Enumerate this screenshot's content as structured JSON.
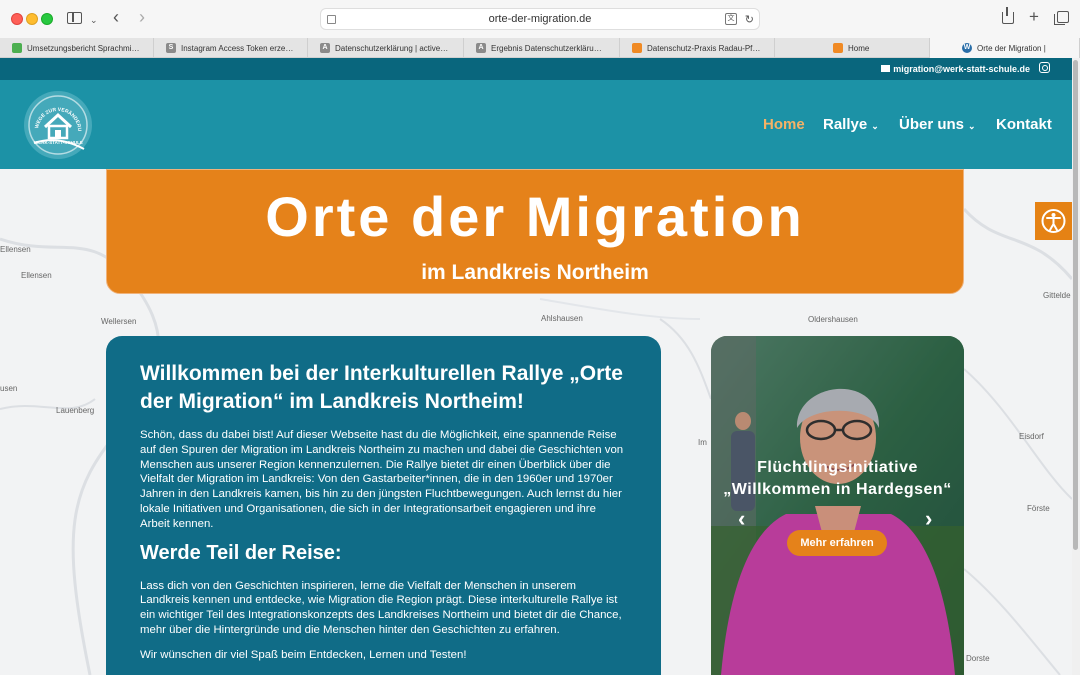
{
  "browser": {
    "url": "orte-der-migration.de",
    "tabs": [
      {
        "label": "Umsetzungsbericht Sprachmi…",
        "fav": "",
        "color": "#4caf50"
      },
      {
        "label": "Instagram Access Token erze…",
        "fav": "S",
        "color": "#8a8a8a"
      },
      {
        "label": "Datenschutzerklärung | active…",
        "fav": "A",
        "color": "#8a8a8a"
      },
      {
        "label": "Ergebnis Datenschutzerkläru…",
        "fav": "A",
        "color": "#8a8a8a"
      },
      {
        "label": "Datenschutz-Praxis Radau-Pf…",
        "fav": "",
        "color": "#f08a24"
      },
      {
        "label": "Home",
        "fav": "",
        "color": "#f08a24"
      },
      {
        "label": "Orte der Migration |",
        "fav": "W",
        "color": "#2a6ea8"
      }
    ]
  },
  "topbar": {
    "email": "migration@werk-statt-schule.de",
    "instagram_icon": "instagram-icon"
  },
  "logo": {
    "arc_text": "WEGE ZUR VERÄNDERUNG",
    "name": "WERK-STATT-SCHULE"
  },
  "nav": {
    "home": "Home",
    "rallye": "Rallye",
    "ueber": "Über uns",
    "kontakt": "Kontakt"
  },
  "banner": {
    "title": "Orte der Migration",
    "subtitle": "im Landkreis Northeim"
  },
  "map_labels": [
    "Ellensen",
    "Ellensen",
    "Wellersen",
    "Ahlshausen",
    "Oldershausen",
    "Gittelde",
    "usen",
    "Lauenberg",
    "Eisdorf",
    "Förste",
    "Dorste",
    "Im"
  ],
  "intro": {
    "heading": "Willkommen bei der Interkulturellen Rallye „Orte der Migration“ im Landkreis Northeim!",
    "paragraph1": "Schön, dass du dabei bist! Auf dieser Webseite hast du die Möglichkeit, eine spannende Reise auf den Spuren der Migration im Landkreis Northeim zu machen und dabei die Geschichten von Menschen aus unserer Region kennenzulernen. Die Rallye bietet dir einen Überblick über die Vielfalt der Migration im Landkreis: Von den Gastarbeiter*innen, die in den 1960er und 1970er Jahren in den Landkreis kamen, bis hin zu den jüngsten Fluchtbewegungen. Auch lernst du hier lokale Initiativen und Organisationen, die sich in der Integrationsarbeit engagieren und ihre Arbeit kennen.",
    "heading2": "Werde Teil der Reise:",
    "paragraph2": "Lass dich von den Geschichten inspirieren, lerne die Vielfalt der Menschen in unserem Landkreis kennen und entdecke, wie Migration die Region prägt. Diese interkulturelle Rallye ist ein wichtiger Teil des Integrationskonzepts des Landkreises Northeim und bietet dir die Chance, mehr über die Hintergründe und die Menschen hinter den Geschichten zu erfahren.",
    "paragraph3": "Wir wünschen dir viel Spaß beim Entdecken, Lernen und Testen!"
  },
  "slider": {
    "caption": "Flüchtlingsinitiative „Willkommen in Hardegsen“",
    "button": "Mehr erfahren"
  },
  "colors": {
    "header": "#1c92a6",
    "topstrip": "#09667d",
    "accent": "#e5821a",
    "card": "#106c87"
  }
}
